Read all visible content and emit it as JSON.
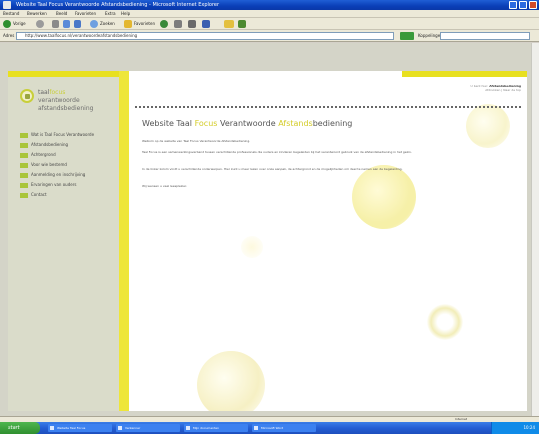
{
  "window": {
    "title": "Website Taal Focus Verantwoorde Afstandsbediening - Microsoft Internet Explorer"
  },
  "menu": [
    "Bestand",
    "Bewerken",
    "Beeld",
    "Favorieten",
    "Extra",
    "Help"
  ],
  "toolbar": {
    "back_label": "Vorige",
    "search_label": "Zoeken",
    "favorites_label": "Favorieten"
  },
  "addressbar": {
    "label": "Adres",
    "url": "http://www.taalfocus.nl/verantwoordeafstandsbediening",
    "go_label": "Ga naar",
    "links_label": "Koppelingen"
  },
  "site": {
    "logo": {
      "line1_a": "taal",
      "line1_b": "focus",
      "line2": "verantwoorde",
      "line3": "afstandsbediening"
    },
    "nav": [
      "Wat is Taal Focus Verantwoorde",
      "Afstandsbediening",
      "Achtergrond",
      "Voor wie bestemd",
      "Aanmelding en inschrijving",
      "Ervaringen van ouders",
      "Contact"
    ],
    "breadcrumb": {
      "prefix": "U bent hier:",
      "current": "Afstandsbediening"
    },
    "sublink": "Afdrukken | Naar de top",
    "heading": {
      "p1": "Website Taal ",
      "accent1": "Focus",
      "p2": " Verantwoorde ",
      "accent2": "Afstands",
      "p3": "bediening"
    },
    "paragraphs": [
      "Welkom op de website van Taal Focus Verantwoorde Afstandsbediening.",
      "Taal Focus is een samenwerkingsverband tussen verschillende professionals die ouders en kinderen begeleiden bij het verantwoord gebruik van de afstandsbediening in het gezin.",
      "In de linker kolom vindt u verschillende onderwerpen. Hier kunt u meer lezen over onze aanpak, de achtergrond en de mogelijkheden om deel te nemen aan de begeleiding.",
      "Wij wensen u veel leesplezier."
    ]
  },
  "status": {
    "text": "Internet"
  },
  "taskbar": {
    "start": "start",
    "tasks": [
      "Website Taal Focus",
      "Verkenner",
      "Mijn documenten",
      "Microsoft Word"
    ],
    "clock": "10:24"
  }
}
